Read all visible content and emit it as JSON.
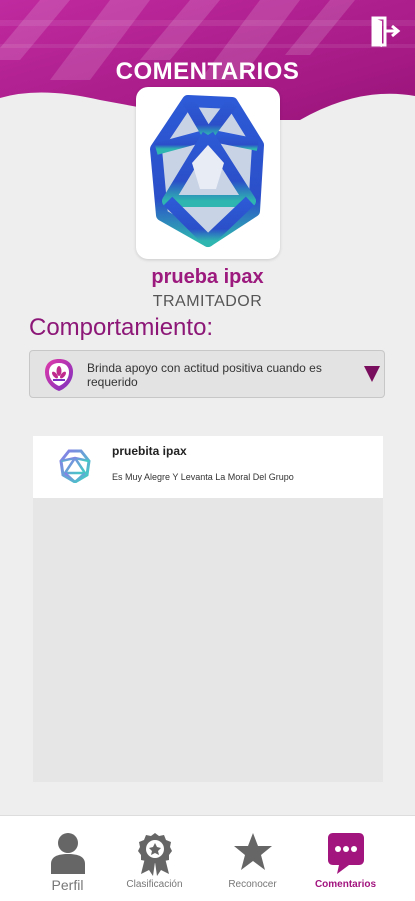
{
  "header": {
    "title": "COMENTARIOS"
  },
  "profile": {
    "name": "prueba ipax",
    "role": "TRAMITADOR"
  },
  "behavior": {
    "label": "Comportamiento:",
    "selected": "Brinda apoyo con actitud positiva cuando es requerido"
  },
  "comments": [
    {
      "author": "pruebita ipax",
      "text": "Es Muy Alegre Y Levanta La Moral Del Grupo"
    }
  ],
  "nav": {
    "perfil": "Perfil",
    "clasificacion": "Clasificación",
    "reconocer": "Reconocer",
    "comentarios": "Comentarios"
  },
  "colors": {
    "brand": "#9c1a7d",
    "active": "#a2157f",
    "header": "#b51d93"
  },
  "icons": {
    "logout": "logout-icon",
    "avatar": "icosahedron-avatar",
    "behavior": "lotus-badge-icon",
    "perfil": "person-icon",
    "clasificacion": "award-badge-icon",
    "reconocer": "star-icon",
    "comentarios": "chat-bubble-icon"
  }
}
